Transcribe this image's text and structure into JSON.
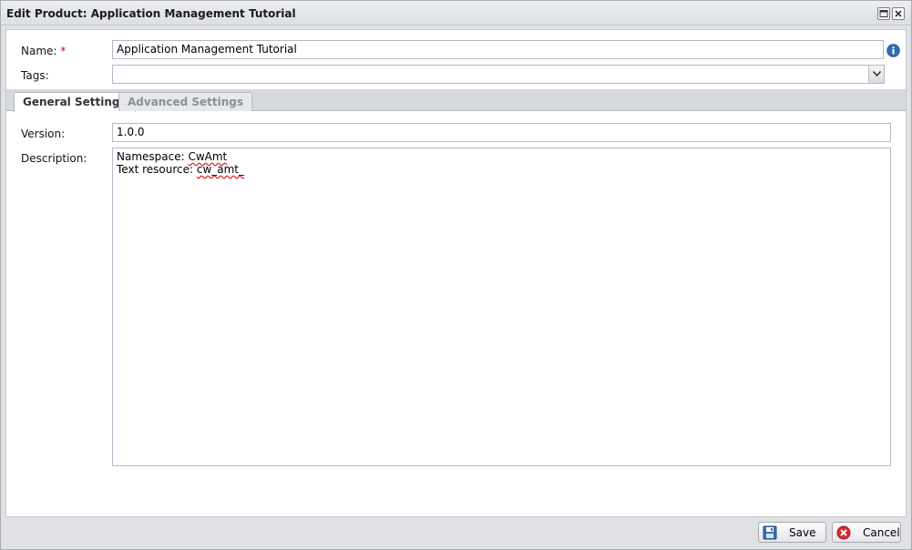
{
  "window": {
    "title": "Edit Product: Application Management Tutorial"
  },
  "form": {
    "name": {
      "label": "Name:",
      "required_mark": "*",
      "value": "Application Management Tutorial"
    },
    "tags": {
      "label": "Tags:",
      "value": ""
    }
  },
  "tabs": [
    {
      "label": "General Settings",
      "active": true
    },
    {
      "label": "Advanced Settings",
      "active": false
    }
  ],
  "general": {
    "version": {
      "label": "Version:",
      "value": "1.0.0"
    },
    "description": {
      "label": "Description:",
      "line1_prefix": "Namespace: ",
      "line1_word": "CwAmt",
      "line2_prefix": "Text resource: ",
      "line2_word": "cw_amt_"
    }
  },
  "buttons": {
    "save": "Save",
    "cancel": "Cancel"
  },
  "colors": {
    "required": "#d40000",
    "info_icon": "#2f6fb5",
    "cancel_icon": "#d9282f"
  }
}
